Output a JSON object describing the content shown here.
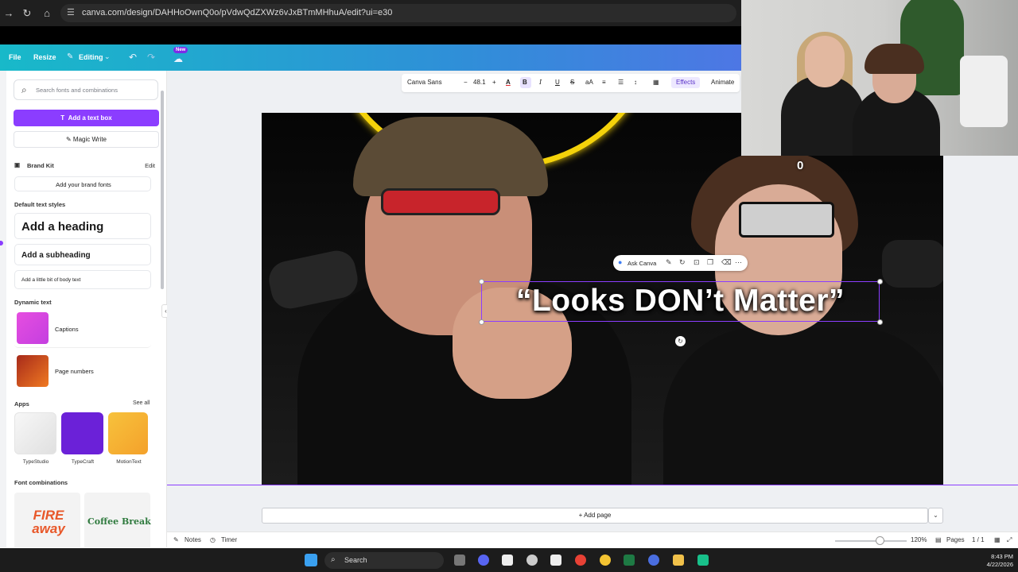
{
  "browser": {
    "url": "canva.com/design/DAHHoOwnQ0o/pVdwQdZXWz6vJxBTmMHhuA/edit?ui=e30"
  },
  "header": {
    "file": "File",
    "resize": "Resize",
    "editing": "Editing",
    "new_badge": "New"
  },
  "panel": {
    "search_placeholder": "Search fonts and combinations",
    "add_text_box": "Add a text box",
    "magic_write": "Magic Write",
    "brand_kit": "Brand Kit",
    "edit": "Edit",
    "add_brand_fonts": "Add your brand fonts",
    "default_text_styles": "Default text styles",
    "add_heading": "Add a heading",
    "add_subheading": "Add a subheading",
    "add_body": "Add a little bit of body text",
    "dynamic_text": "Dynamic text",
    "captions": "Captions",
    "page_numbers": "Page numbers",
    "apps": "Apps",
    "see_all": "See all",
    "app_items": [
      "TypeStudio",
      "TypeCraft",
      "MotionText"
    ],
    "font_combinations": "Font combinations",
    "font_combo_1": "FIRE away",
    "font_combo_2": "Coffee Break"
  },
  "toolbar": {
    "font": "Canva Sans",
    "font_size": "48.1",
    "effects": "Effects",
    "animate": "Animate"
  },
  "canvas": {
    "caption": "“Looks DON’t Matter”",
    "ask_canva": "Ask Canva",
    "add_page": "+ Add page"
  },
  "webcam": {
    "counter": "0"
  },
  "footer": {
    "notes": "Notes",
    "timer": "Timer",
    "zoom": "120%",
    "pages": "Pages",
    "page_count": "1 / 1"
  },
  "taskbar": {
    "search": "Search",
    "time": "8:43 PM",
    "date": "4/22/2026"
  },
  "colors": {
    "accent": "#8b3dff",
    "header_start": "#18b9c9",
    "header_end": "#6b5ff0"
  }
}
